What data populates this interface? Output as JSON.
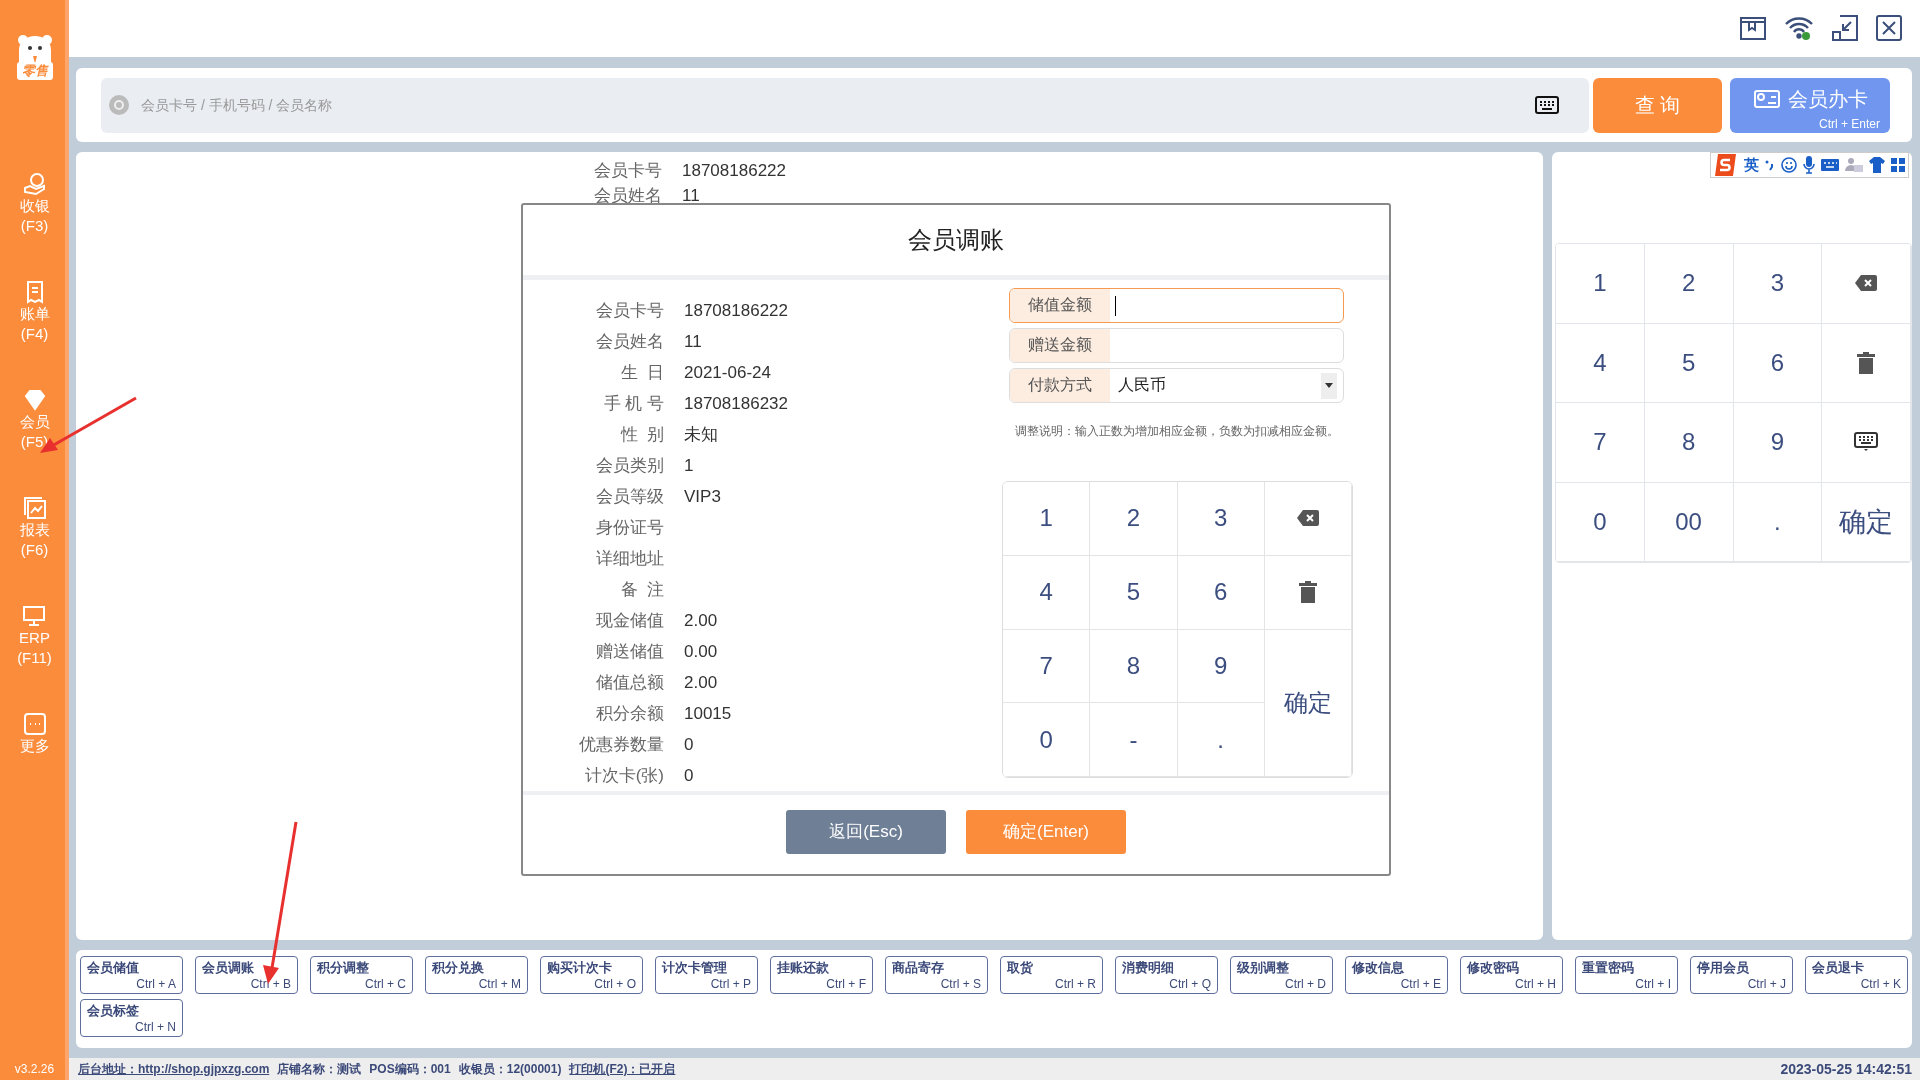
{
  "sidebar": {
    "logo_text": "零售",
    "items": [
      {
        "label": "收银",
        "shortcut": "(F3)"
      },
      {
        "label": "账单",
        "shortcut": "(F4)"
      },
      {
        "label": "会员",
        "shortcut": "(F5)"
      },
      {
        "label": "报表",
        "shortcut": "(F6)"
      },
      {
        "label": "ERP",
        "shortcut": "(F11)"
      },
      {
        "label": "更多"
      }
    ],
    "version": "v3.2.26"
  },
  "search": {
    "placeholder": "会员卡号 / 手机号码 / 会员名称",
    "query_button": "查 询",
    "card_button": {
      "label": "会员办卡",
      "shortcut": "Ctrl + Enter"
    }
  },
  "background_info": [
    {
      "label": "会员卡号",
      "value": "18708186222"
    },
    {
      "label": "会员姓名",
      "value": "11"
    }
  ],
  "dialog": {
    "title": "会员调账",
    "info": [
      {
        "label": "会员卡号",
        "value": "18708186222"
      },
      {
        "label": "会员姓名",
        "value": "11"
      },
      {
        "label": "生  日",
        "value": "2021-06-24"
      },
      {
        "label": "手 机 号",
        "value": "18708186232"
      },
      {
        "label": "性  别",
        "value": "未知"
      },
      {
        "label": "会员类别",
        "value": "1"
      },
      {
        "label": "会员等级",
        "value": "VIP3"
      },
      {
        "label": "身份证号"
      },
      {
        "label": "详细地址"
      },
      {
        "label": "备  注"
      },
      {
        "label": "现金储值",
        "value": "2.00"
      },
      {
        "label": "赠送储值",
        "value": "0.00"
      },
      {
        "label": "储值总额",
        "value": "2.00"
      },
      {
        "label": "积分余额",
        "value": "10015"
      },
      {
        "label": "优惠券数量",
        "value": "0"
      },
      {
        "label": "计次卡(张)",
        "value": "0"
      }
    ],
    "fields": [
      {
        "label": "储值金额",
        "kind": "input",
        "focused": true
      },
      {
        "label": "赠送金额",
        "kind": "input",
        "focused": false
      },
      {
        "label": "付款方式",
        "kind": "select",
        "value": "人民币",
        "focused": false
      }
    ],
    "note": "调整说明：输入正数为增加相应金额，负数为扣减相应金额。",
    "keypad": [
      {
        "kind": "digit",
        "label": "1"
      },
      {
        "kind": "digit",
        "label": "2"
      },
      {
        "kind": "digit",
        "label": "3"
      },
      {
        "kind": "backspace"
      },
      {
        "kind": "digit",
        "label": "4"
      },
      {
        "kind": "digit",
        "label": "5"
      },
      {
        "kind": "digit",
        "label": "6"
      },
      {
        "kind": "delete"
      },
      {
        "kind": "digit",
        "label": "7"
      },
      {
        "kind": "digit",
        "label": "8"
      },
      {
        "kind": "digit",
        "label": "9"
      },
      {
        "kind": "confirm",
        "label": "确定"
      },
      {
        "kind": "digit",
        "label": "0"
      },
      {
        "kind": "digit",
        "label": "-"
      },
      {
        "kind": "digit",
        "label": "."
      }
    ],
    "buttons": [
      {
        "label": "返回(Esc)",
        "kind": "secondary"
      },
      {
        "label": "确定(Enter)",
        "kind": "primary"
      }
    ]
  },
  "ime_toolbar": {
    "mode": "英"
  },
  "side_keypad": [
    {
      "kind": "digit",
      "label": "1"
    },
    {
      "kind": "digit",
      "label": "2"
    },
    {
      "kind": "digit",
      "label": "3"
    },
    {
      "kind": "backspace"
    },
    {
      "kind": "digit",
      "label": "4"
    },
    {
      "kind": "digit",
      "label": "5"
    },
    {
      "kind": "digit",
      "label": "6"
    },
    {
      "kind": "delete"
    },
    {
      "kind": "digit",
      "label": "7"
    },
    {
      "kind": "digit",
      "label": "8"
    },
    {
      "kind": "digit",
      "label": "9"
    },
    {
      "kind": "keyboard"
    },
    {
      "kind": "digit",
      "label": "0"
    },
    {
      "kind": "digit",
      "label": "00"
    },
    {
      "kind": "digit",
      "label": "."
    },
    {
      "kind": "confirm",
      "label": "确定"
    }
  ],
  "shortcuts": [
    {
      "label": "会员储值",
      "shortcut": "Ctrl + A"
    },
    {
      "label": "会员调账",
      "shortcut": "Ctrl + B"
    },
    {
      "label": "积分调整",
      "shortcut": "Ctrl + C"
    },
    {
      "label": "积分兑换",
      "shortcut": "Ctrl + M"
    },
    {
      "label": "购买计次卡",
      "shortcut": "Ctrl + O"
    },
    {
      "label": "计次卡管理",
      "shortcut": "Ctrl + P"
    },
    {
      "label": "挂账还款",
      "shortcut": "Ctrl + F"
    },
    {
      "label": "商品寄存",
      "shortcut": "Ctrl + S"
    },
    {
      "label": "取货",
      "shortcut": "Ctrl + R"
    },
    {
      "label": "消费明细",
      "shortcut": "Ctrl + Q"
    },
    {
      "label": "级别调整",
      "shortcut": "Ctrl + D"
    },
    {
      "label": "修改信息",
      "shortcut": "Ctrl + E"
    },
    {
      "label": "修改密码",
      "shortcut": "Ctrl + H"
    },
    {
      "label": "重置密码",
      "shortcut": "Ctrl + I"
    },
    {
      "label": "停用会员",
      "shortcut": "Ctrl + J"
    },
    {
      "label": "会员退卡",
      "shortcut": "Ctrl + K"
    },
    {
      "label": "会员标签",
      "shortcut": "Ctrl + N"
    }
  ],
  "status_bar": {
    "items": [
      {
        "text": "后台地址：http://shop.gjpxzg.com",
        "link": true
      },
      {
        "text": "店铺名称：测试",
        "link": false
      },
      {
        "text": "POS编码：001",
        "link": false
      },
      {
        "text": "收银员：12(00001)",
        "link": false
      },
      {
        "text": "打印机(F2)：已开启",
        "link": true
      }
    ],
    "datetime": "2023-05-25 14:42:51"
  }
}
